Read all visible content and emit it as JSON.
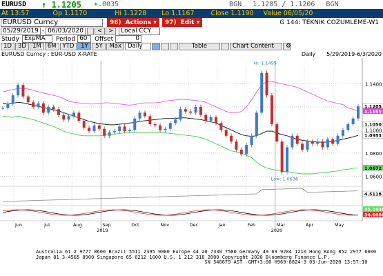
{
  "header": {
    "ticker": "EURUSD",
    "last": "↑ 1.1205",
    "change": "+.0035",
    "bgn_label": "BGN",
    "bid_ask": "1.1205 / 1.1206",
    "bid_ask_label": "BGN"
  },
  "quote_bar": {
    "at": "At 13:57",
    "open": "Op 1.1170",
    "high": "Hi 1.1228",
    "low": "Lo 1.1167",
    "close": "Close 1.1190",
    "value": "Value 06/05/20"
  },
  "toolbar": {
    "security": "EURUSD Curncy",
    "actions_num": "96)",
    "actions_label": "Actions ▾",
    "edit_num": "97)",
    "edit_label": "Edit ▾",
    "function_title": "G 144: TEKNIK COZUMLEME-W1"
  },
  "range": {
    "start": "05/29/2019",
    "end": "06/03/2020",
    "currency": "Local CCY"
  },
  "study": {
    "label": "Study",
    "type": "ExpMA",
    "period_label": "Period",
    "period": "60",
    "offset_label": "Offset",
    "offset": "0"
  },
  "periods": {
    "items": [
      "1D",
      "3D",
      "1M",
      "6M",
      "YTD",
      "1Y",
      "5Y",
      "Max"
    ],
    "selected": "1Y",
    "frequency": "Daily",
    "table_label": "Table",
    "chart_content_label": "Chart Content"
  },
  "chart_header": {
    "left": "EURUSD Curncy : EUR-USD X-RATE",
    "freq": "Daily",
    "range": "5/29/2019-6/3/2020"
  },
  "chart_data": {
    "type": "line",
    "title": "EURUSD Curncy : EUR-USD X-RATE",
    "ylim": [
      1.056,
      1.16
    ],
    "y_ticks": [
      1.14,
      1.12,
      1.1,
      1.08,
      1.06
    ],
    "x_month_labels": [
      "Jun",
      "Jul",
      "Aug",
      "Sep",
      "Oct",
      "Nov",
      "Dec",
      "Jan",
      "Feb",
      "Mar",
      "Apr",
      "May"
    ],
    "x_year_labels": [
      {
        "label": "2019",
        "after": "Sep"
      },
      {
        "label": "2020",
        "after": "Mar"
      }
    ],
    "price": [
      1.119,
      1.123,
      1.13,
      1.139,
      1.129,
      1.124,
      1.12,
      1.123,
      1.115,
      1.12,
      1.118,
      1.113,
      1.109,
      1.112,
      1.115,
      1.108,
      1.102,
      1.099,
      1.104,
      1.101,
      1.095,
      1.098,
      1.099,
      1.103,
      1.099,
      1.1,
      1.11,
      1.115,
      1.112,
      1.105,
      1.104,
      1.1,
      1.101,
      1.106,
      1.109,
      1.118,
      1.116,
      1.115,
      1.12,
      1.113,
      1.108,
      1.111,
      1.106,
      1.1,
      1.095,
      1.09,
      1.083,
      1.079,
      1.087,
      1.095,
      1.115,
      1.1495,
      1.13,
      1.105,
      1.09,
      1.0636,
      1.085,
      1.095,
      1.088,
      1.083,
      1.09,
      1.088,
      1.09,
      1.085,
      1.092,
      1.088,
      1.095,
      1.1,
      1.105,
      1.11,
      1.1205
    ],
    "ema": [
      1.123,
      1.1225,
      1.123,
      1.124,
      1.1235,
      1.1225,
      1.1215,
      1.1205,
      1.1195,
      1.1185,
      1.1175,
      1.1165,
      1.115,
      1.1135,
      1.112,
      1.1105,
      1.109,
      1.1075,
      1.1065,
      1.1055,
      1.105,
      1.1045,
      1.1045,
      1.105,
      1.1055,
      1.106,
      1.1065,
      1.1075,
      1.108,
      1.1085,
      1.109,
      1.1095,
      1.11,
      1.11,
      1.11,
      1.1105,
      1.1105,
      1.11,
      1.1095,
      1.109,
      1.108,
      1.107,
      1.106,
      1.104,
      1.102,
      1.1,
      1.098,
      1.096,
      1.095,
      1.0945,
      1.095,
      1.097,
      1.099,
      1.099,
      1.0975,
      1.096,
      1.095,
      1.0935,
      1.092,
      1.091,
      1.0905,
      1.09,
      1.0895,
      1.0895,
      1.0895,
      1.09,
      1.091,
      1.092,
      1.093,
      1.094,
      1.0953
    ],
    "upper_band": [
      1.133,
      1.134,
      1.135,
      1.136,
      1.136,
      1.1355,
      1.1345,
      1.133,
      1.132,
      1.131,
      1.13,
      1.129,
      1.127,
      1.125,
      1.124,
      1.1235,
      1.123,
      1.1225,
      1.1225,
      1.123,
      1.1235,
      1.1235,
      1.123,
      1.1225,
      1.122,
      1.1215,
      1.122,
      1.123,
      1.1235,
      1.1235,
      1.1235,
      1.124,
      1.125,
      1.1255,
      1.126,
      1.1265,
      1.1265,
      1.126,
      1.1255,
      1.125,
      1.124,
      1.122,
      1.12,
      1.118,
      1.116,
      1.115,
      1.115,
      1.116,
      1.12,
      1.126,
      1.133,
      1.139,
      1.142,
      1.142,
      1.141,
      1.14,
      1.139,
      1.138,
      1.137,
      1.135,
      1.133,
      1.131,
      1.129,
      1.127,
      1.125,
      1.124,
      1.123,
      1.122,
      1.119,
      1.118,
      1.1165
    ],
    "lower_band": [
      1.112,
      1.1115,
      1.111,
      1.112,
      1.111,
      1.11,
      1.109,
      1.1075,
      1.106,
      1.1045,
      1.103,
      1.101,
      1.099,
      1.0975,
      1.0965,
      1.0955,
      1.095,
      1.095,
      1.095,
      1.095,
      1.0955,
      1.096,
      1.0965,
      1.097,
      1.0975,
      1.0975,
      1.0975,
      1.0975,
      1.0975,
      1.0975,
      1.0975,
      1.0975,
      1.0975,
      1.097,
      1.0965,
      1.096,
      1.0955,
      1.095,
      1.0945,
      1.0935,
      1.092,
      1.09,
      1.088,
      1.086,
      1.084,
      1.082,
      1.081,
      1.08,
      1.078,
      1.076,
      1.072,
      1.069,
      1.067,
      1.066,
      1.065,
      1.064,
      1.064,
      1.063,
      1.0625,
      1.062,
      1.062,
      1.062,
      1.0625,
      1.063,
      1.0635,
      1.064,
      1.0645,
      1.0655,
      1.066,
      1.0668,
      1.0672
    ],
    "high_annotation": "Hi: 1.1495",
    "low_annotation": "Low: 1.0636",
    "tags": [
      {
        "value": 1.1205,
        "label": "1.1205",
        "color": "#ffffff",
        "text": "#000000"
      },
      {
        "value": 1.1165,
        "label": "1.1165",
        "color": "#e040e0",
        "text": "#ffffff"
      },
      {
        "value": 1.105,
        "label": "1.1050",
        "color": "#ffffff",
        "text": "#000000"
      },
      {
        "value": 1.0953,
        "label": "1.0953",
        "color": "#ffffff",
        "text": "#000000"
      },
      {
        "value": 1.0672,
        "label": "1.0672",
        "color": "#60e060",
        "text": "#000000"
      }
    ],
    "sub_panel_tag": "4.5118",
    "osc_tags": [
      "35.1646",
      "34.6086"
    ],
    "colors": {
      "price": "#c03030",
      "ema": "#222222",
      "upper": "#e060e0",
      "lower": "#40d040",
      "up_bar": "#3a7ad0"
    }
  },
  "footer": {
    "line1": "Australia 61 2 9777 8600 Brazil 5511 2395 9000 Europe 44 20 7330 7500 Germany 49 69 9204 1210 Hong Kong 852 2977 6000",
    "line2": "Japan 81 3 4565 8900        Singapore 65 6212 1000       U.S. 1 212 318 2000          Copyright 2020 Bloomberg Finance L.P.",
    "line3": "                                                          SN 546679 AST  GMT+3:00 H969-8824-3 03-Jun-2020 13:57:10"
  }
}
